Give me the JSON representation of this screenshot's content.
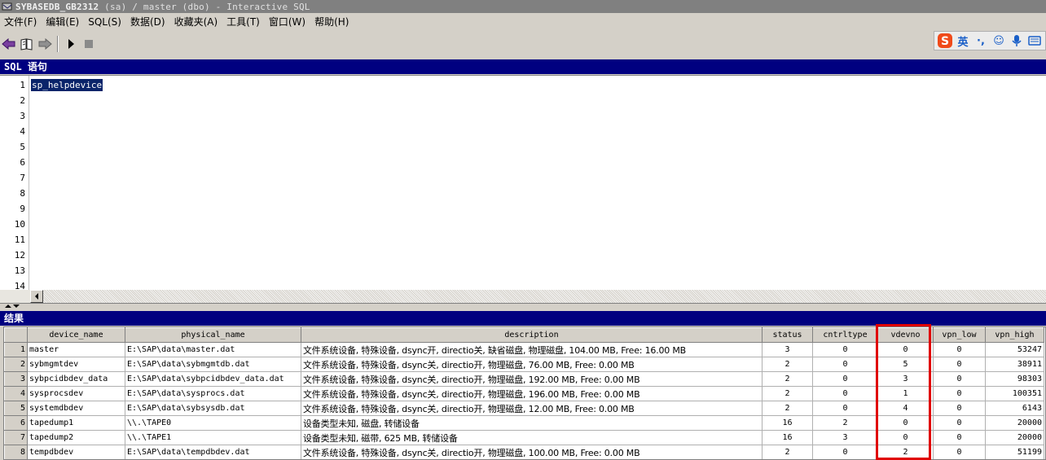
{
  "window": {
    "title_bold": "SYBASEDB_GB2312",
    "title_rest": " (sa) / master (dbo) - Interactive SQL"
  },
  "menu": [
    "文件(F)",
    "编辑(E)",
    "SQL(S)",
    "数据(D)",
    "收藏夹(A)",
    "工具(T)",
    "窗口(W)",
    "帮助(H)"
  ],
  "toolbar": {
    "back": "back-arrow",
    "open": "open-book",
    "forward": "forward-arrow",
    "execute": "play",
    "stop": "stop"
  },
  "ime": {
    "logo": "S",
    "mode": "英",
    "punct": "·,",
    "emoji": "☺",
    "voice": "🎤",
    "keyboard": "⌨"
  },
  "sql_pane": {
    "title": "SQL 语句",
    "lines": [
      "1",
      "2",
      "3",
      "4",
      "5",
      "6",
      "7",
      "8",
      "9",
      "10",
      "11",
      "12",
      "13",
      "14"
    ],
    "code": "sp_helpdevice"
  },
  "results_pane": {
    "title": "结果"
  },
  "grid": {
    "columns": [
      "device_name",
      "physical_name",
      "description",
      "status",
      "cntrltype",
      "vdevno",
      "vpn_low",
      "vpn_high"
    ],
    "rows": [
      {
        "n": "1",
        "device_name": "master",
        "physical_name": "E:\\SAP\\data\\master.dat",
        "description": "文件系统设备, 特殊设备, dsync开, directio关, 缺省磁盘, 物理磁盘, 104.00 MB, Free: 16.00 MB",
        "status": "3",
        "cntrltype": "0",
        "vdevno": "0",
        "vpn_low": "0",
        "vpn_high": "53247"
      },
      {
        "n": "2",
        "device_name": "sybmgmtdev",
        "physical_name": "E:\\SAP\\data\\sybmgmtdb.dat",
        "description": "文件系统设备, 特殊设备, dsync关, directio开, 物理磁盘, 76.00 MB, Free: 0.00 MB",
        "status": "2",
        "cntrltype": "0",
        "vdevno": "5",
        "vpn_low": "0",
        "vpn_high": "38911"
      },
      {
        "n": "3",
        "device_name": "sybpcidbdev_data",
        "physical_name": "E:\\SAP\\data\\sybpcidbdev_data.dat",
        "description": "文件系统设备, 特殊设备, dsync关, directio开, 物理磁盘, 192.00 MB, Free: 0.00 MB",
        "status": "2",
        "cntrltype": "0",
        "vdevno": "3",
        "vpn_low": "0",
        "vpn_high": "98303"
      },
      {
        "n": "4",
        "device_name": "sysprocsdev",
        "physical_name": "E:\\SAP\\data\\sysprocs.dat",
        "description": "文件系统设备, 特殊设备, dsync关, directio开, 物理磁盘, 196.00 MB, Free: 0.00 MB",
        "status": "2",
        "cntrltype": "0",
        "vdevno": "1",
        "vpn_low": "0",
        "vpn_high": "100351"
      },
      {
        "n": "5",
        "device_name": "systemdbdev",
        "physical_name": "E:\\SAP\\data\\sybsysdb.dat",
        "description": "文件系统设备, 特殊设备, dsync关, directio开, 物理磁盘, 12.00 MB, Free: 0.00 MB",
        "status": "2",
        "cntrltype": "0",
        "vdevno": "4",
        "vpn_low": "0",
        "vpn_high": "6143"
      },
      {
        "n": "6",
        "device_name": "tapedump1",
        "physical_name": "\\\\.\\TAPE0",
        "description": "设备类型未知, 磁盘, 转储设备",
        "status": "16",
        "cntrltype": "2",
        "vdevno": "0",
        "vpn_low": "0",
        "vpn_high": "20000"
      },
      {
        "n": "7",
        "device_name": "tapedump2",
        "physical_name": "\\\\.\\TAPE1",
        "description": "设备类型未知, 磁带,         625 MB, 转储设备",
        "status": "16",
        "cntrltype": "3",
        "vdevno": "0",
        "vpn_low": "0",
        "vpn_high": "20000"
      },
      {
        "n": "8",
        "device_name": "tempdbdev",
        "physical_name": "E:\\SAP\\data\\tempdbdev.dat",
        "description": "文件系统设备, 特殊设备, dsync关, directio开, 物理磁盘, 100.00 MB, Free: 0.00 MB",
        "status": "2",
        "cntrltype": "0",
        "vdevno": "2",
        "vpn_low": "0",
        "vpn_high": "51199"
      }
    ]
  },
  "highlight": {
    "column": "vdevno",
    "color": "#e00000"
  }
}
